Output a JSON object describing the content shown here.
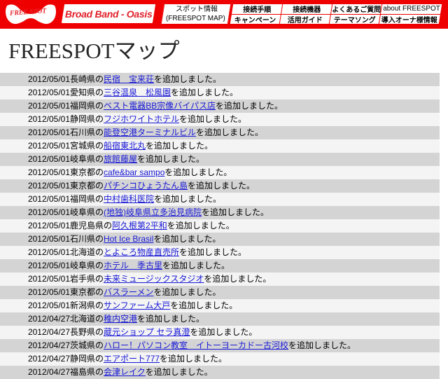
{
  "header": {
    "logo_text": "FREE SPOT",
    "brand_plaque": "Broad Band - Oasis",
    "spot_info_line1": "スポット情報",
    "spot_info_line2": "(FREESPOT MAP)",
    "nav": [
      {
        "label": "接続手順",
        "latin": false
      },
      {
        "label": "接続機器",
        "latin": false
      },
      {
        "label": "よくあるご質問",
        "latin": false
      },
      {
        "label": "about FREESPOT",
        "latin": true
      },
      {
        "label": "キャンペーン",
        "latin": false
      },
      {
        "label": "活用ガイド",
        "latin": false
      },
      {
        "label": "テーマソング",
        "latin": false
      },
      {
        "label": "導入オーナ様情報",
        "latin": false
      }
    ]
  },
  "page_title": "FREESPOTマップ",
  "colors": {
    "brand_red": "#ef0000",
    "link_blue": "#1818d6",
    "row_odd": "#d4d4d4",
    "row_even": "#f4f4f4"
  },
  "news": {
    "suffix": "を追加しました。",
    "rows": [
      {
        "date": "2012/05/01",
        "prefix": "長崎県の",
        "link": "民宿　宝来荘"
      },
      {
        "date": "2012/05/01",
        "prefix": "愛知県の",
        "link": "三谷温泉　松風園"
      },
      {
        "date": "2012/05/01",
        "prefix": "福岡県の",
        "link": "ベスト電器BB宗像バイパス店"
      },
      {
        "date": "2012/05/01",
        "prefix": "静岡県の",
        "link": "フジホワイトホテル"
      },
      {
        "date": "2012/05/01",
        "prefix": "石川県の",
        "link": "能登空港ターミナルビル"
      },
      {
        "date": "2012/05/01",
        "prefix": "宮城県の",
        "link": "船宿東北丸"
      },
      {
        "date": "2012/05/01",
        "prefix": "岐阜県の",
        "link": "旅館藤屋"
      },
      {
        "date": "2012/05/01",
        "prefix": "東京都の",
        "link": "cafe&bar sampo"
      },
      {
        "date": "2012/05/01",
        "prefix": "東京都の",
        "link": "パチンコひょうたん島"
      },
      {
        "date": "2012/05/01",
        "prefix": "福岡県の",
        "link": "中村歯科医院"
      },
      {
        "date": "2012/05/01",
        "prefix": "岐阜県の",
        "link": "(地独)岐阜県立多治見病院"
      },
      {
        "date": "2012/05/01",
        "prefix": "鹿児島県の",
        "link": "阿久根第2平和"
      },
      {
        "date": "2012/05/01",
        "prefix": "石川県の",
        "link": "Hot Ice Brasil"
      },
      {
        "date": "2012/05/01",
        "prefix": "北海道の",
        "link": "とよころ物産直売所"
      },
      {
        "date": "2012/05/01",
        "prefix": "岐阜県の",
        "link": "ホテル　季古里"
      },
      {
        "date": "2012/05/01",
        "prefix": "岩手県の",
        "link": "未来ミュージックスタジオ"
      },
      {
        "date": "2012/05/01",
        "prefix": "東京都の",
        "link": "バスラーメン"
      },
      {
        "date": "2012/05/01",
        "prefix": "新潟県の",
        "link": "サンファーム大戸"
      },
      {
        "date": "2012/04/27",
        "prefix": "北海道の",
        "link": "稚内空港"
      },
      {
        "date": "2012/04/27",
        "prefix": "長野県の",
        "link": "蔵元ショップ セラ真澄"
      },
      {
        "date": "2012/04/27",
        "prefix": "茨城県の",
        "link": "ハロー！パソコン教室　イトーヨーカドー古河校"
      },
      {
        "date": "2012/04/27",
        "prefix": "静岡県の",
        "link": "エアポート777"
      },
      {
        "date": "2012/04/27",
        "prefix": "福島県の",
        "link": "会津レイク"
      }
    ]
  }
}
